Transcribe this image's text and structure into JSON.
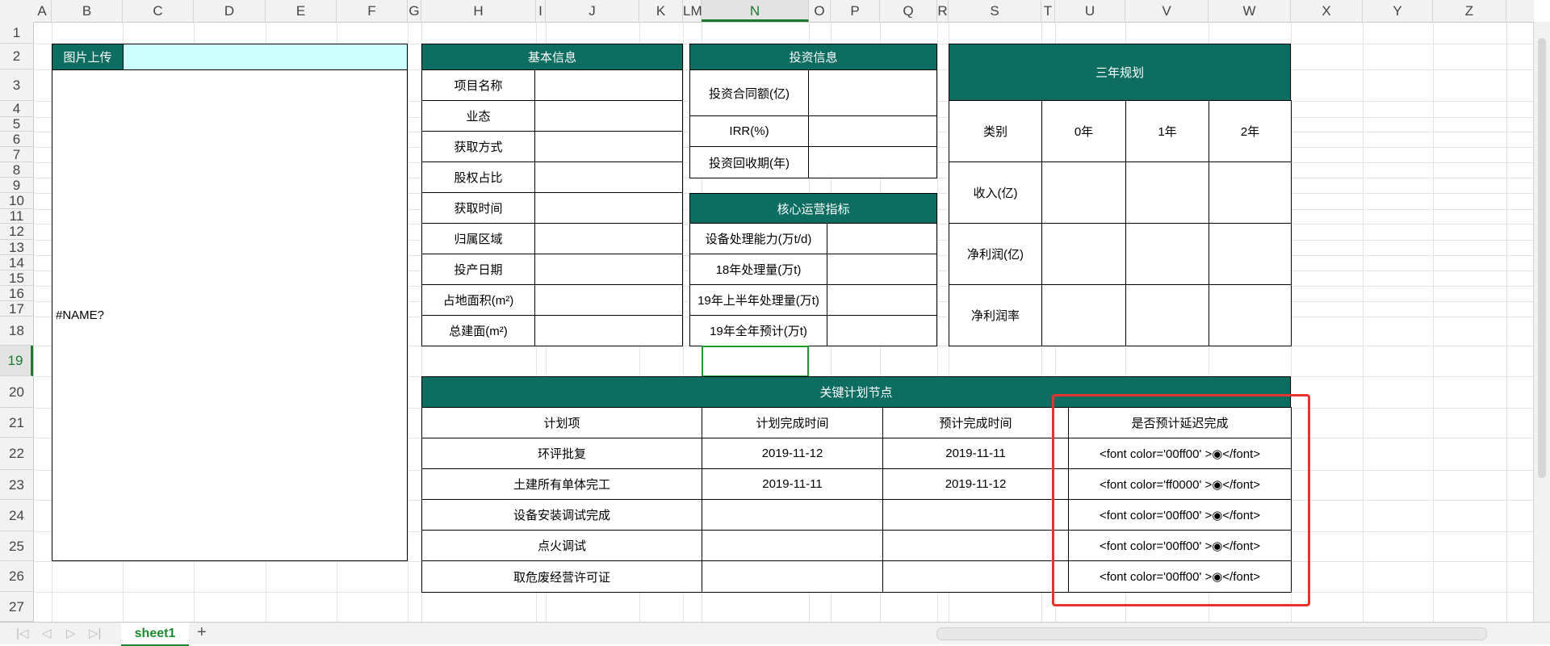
{
  "columns": [
    "A",
    "B",
    "C",
    "D",
    "E",
    "F",
    "G",
    "H",
    "I",
    "J",
    "K",
    "LM",
    "N",
    "O",
    "P",
    "Q",
    "R",
    "S",
    "T",
    "U",
    "V",
    "W",
    "X",
    "Y",
    "Z"
  ],
  "rows": [
    "1",
    "2",
    "3",
    "4",
    "5",
    "6",
    "7",
    "8",
    "9",
    "10",
    "11",
    "12",
    "13",
    "14",
    "15",
    "16",
    "17",
    "18",
    "19",
    "20",
    "21",
    "22",
    "23",
    "24",
    "25",
    "26",
    "27"
  ],
  "image_block": {
    "header": "图片上传",
    "content": "#NAME?"
  },
  "basic_info": {
    "title": "基本信息",
    "labels": [
      "项目名称",
      "业态",
      "获取方式",
      "股权占比",
      "获取时间",
      "归属区域",
      "投产日期",
      "占地面积(m²)",
      "总建面(m²)"
    ]
  },
  "investment": {
    "title": "投资信息",
    "labels": [
      "投资合同额(亿)",
      "IRR(%)",
      "投资回收期(年)"
    ]
  },
  "core_ops": {
    "title": "核心运营指标",
    "labels": [
      "设备处理能力(万t/d)",
      "18年处理量(万t)",
      "19年上半年处理量(万t)",
      "19年全年预计(万t)"
    ]
  },
  "three_year": {
    "title": "三年规划",
    "headers": [
      "类别",
      "0年",
      "1年",
      "2年"
    ],
    "rows": [
      "收入(亿)",
      "净利润(亿)",
      "净利润率"
    ]
  },
  "key_plan": {
    "title": "关键计划节点",
    "headers": [
      "计划项",
      "计划完成时间",
      "预计完成时间",
      "是否预计延迟完成"
    ],
    "rows": [
      {
        "item": "环评批复",
        "planned": "2019-11-12",
        "expected": "2019-11-11",
        "delay": "<font color='00ff00' >◉</font>"
      },
      {
        "item": "土建所有单体完工",
        "planned": "2019-11-11",
        "expected": "2019-11-12",
        "delay": "<font color='ff0000' >◉</font>"
      },
      {
        "item": "设备安装调试完成",
        "planned": "",
        "expected": "",
        "delay": "<font color='00ff00' >◉</font>"
      },
      {
        "item": "点火调试",
        "planned": "",
        "expected": "",
        "delay": "<font color='00ff00' >◉</font>"
      },
      {
        "item": "取危废经营许可证",
        "planned": "",
        "expected": "",
        "delay": "<font color='00ff00' >◉</font>"
      }
    ]
  },
  "sheet_tab": "sheet1",
  "add_tab": "+",
  "colors": {
    "header_green": "#0e6d61",
    "header_cyan": "#ccffff",
    "selection": "#1b9a2e",
    "highlight": "#e8322d"
  }
}
